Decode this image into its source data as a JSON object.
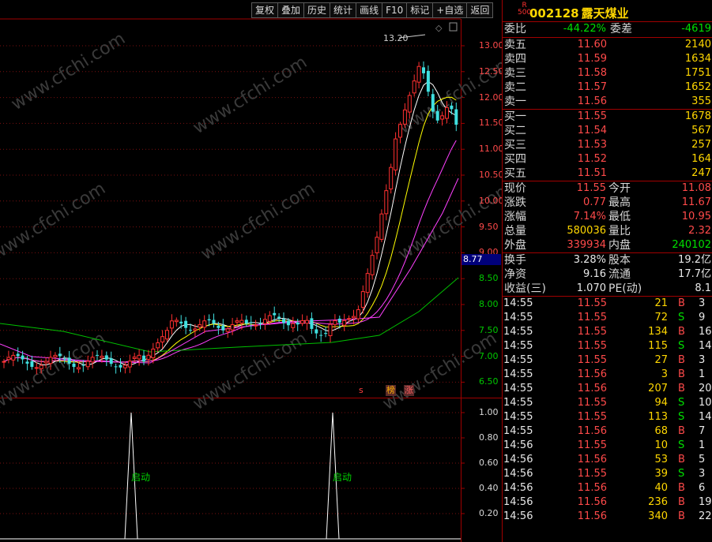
{
  "toolbar": {
    "buttons": [
      "复权",
      "叠加",
      "历史",
      "统计",
      "画线",
      "F10",
      "标记",
      "+自选",
      "返回"
    ]
  },
  "chart": {
    "peak_label": "13.20",
    "price_axis": [
      {
        "v": "13.00",
        "c": "red"
      },
      {
        "v": "12.50",
        "c": "red"
      },
      {
        "v": "12.00",
        "c": "red"
      },
      {
        "v": "11.50",
        "c": "red"
      },
      {
        "v": "11.00",
        "c": "red"
      },
      {
        "v": "10.50",
        "c": "red"
      },
      {
        "v": "10.00",
        "c": "red"
      },
      {
        "v": "9.50",
        "c": "red"
      },
      {
        "v": "9.00",
        "c": "red"
      },
      {
        "v": "8.50",
        "c": "green"
      },
      {
        "v": "8.00",
        "c": "green"
      },
      {
        "v": "7.50",
        "c": "green"
      },
      {
        "v": "7.00",
        "c": "green"
      },
      {
        "v": "6.50",
        "c": "green"
      }
    ],
    "current_price_box": "8.77",
    "tags": [
      {
        "t": "s",
        "c": "#ff4040"
      },
      {
        "t": "榜",
        "c": "#ffb000"
      },
      {
        "t": "涨",
        "c": "#ff6060"
      }
    ],
    "indicator_axis": [
      "1.00",
      "0.80",
      "0.60",
      "0.40",
      "0.20"
    ],
    "indicator_label": "启动",
    "watermark": "www.cfchi.com"
  },
  "panel": {
    "r_badge_top": "R",
    "r_badge_bottom": "500",
    "code": "002128",
    "name": "露天煤业",
    "weibi_label": "委比",
    "weibi_value": "-44.22%",
    "weicha_label": "委差",
    "weicha_value": "-4619",
    "sells": [
      {
        "label": "卖五",
        "price": "11.60",
        "vol": "2140"
      },
      {
        "label": "卖四",
        "price": "11.59",
        "vol": "1634"
      },
      {
        "label": "卖三",
        "price": "11.58",
        "vol": "1751"
      },
      {
        "label": "卖二",
        "price": "11.57",
        "vol": "1652"
      },
      {
        "label": "卖一",
        "price": "11.56",
        "vol": "355"
      }
    ],
    "buys": [
      {
        "label": "买一",
        "price": "11.55",
        "vol": "1678"
      },
      {
        "label": "买二",
        "price": "11.54",
        "vol": "567"
      },
      {
        "label": "买三",
        "price": "11.53",
        "vol": "257"
      },
      {
        "label": "买四",
        "price": "11.52",
        "vol": "164"
      },
      {
        "label": "买五",
        "price": "11.51",
        "vol": "247"
      }
    ],
    "quote": [
      {
        "l1": "现价",
        "v1": "11.55",
        "c1": "red",
        "l2": "今开",
        "v2": "11.08",
        "c2": "red"
      },
      {
        "l1": "涨跌",
        "v1": "0.77",
        "c1": "red",
        "l2": "最高",
        "v2": "11.67",
        "c2": "red"
      },
      {
        "l1": "涨幅",
        "v1": "7.14%",
        "c1": "red",
        "l2": "最低",
        "v2": "10.95",
        "c2": "red"
      },
      {
        "l1": "总量",
        "v1": "580036",
        "c1": "yellow",
        "l2": "量比",
        "v2": "2.32",
        "c2": "red"
      },
      {
        "l1": "外盘",
        "v1": "339934",
        "c1": "red",
        "l2": "内盘",
        "v2": "240102",
        "c2": "green"
      }
    ],
    "fund": [
      {
        "l1": "换手",
        "v1": "3.28%",
        "l2": "股本",
        "v2": "19.2亿"
      },
      {
        "l1": "净资",
        "v1": "9.16",
        "l2": "流通",
        "v2": "17.7亿"
      },
      {
        "l1": "收益(三)",
        "v1": "1.070",
        "l2": "PE(动)",
        "v2": "8.1"
      }
    ],
    "ticks": [
      {
        "t": "14:55",
        "p": "11.55",
        "v": "21",
        "bs": "B",
        "n": "3"
      },
      {
        "t": "14:55",
        "p": "11.55",
        "v": "72",
        "bs": "S",
        "n": "9"
      },
      {
        "t": "14:55",
        "p": "11.55",
        "v": "134",
        "bs": "B",
        "n": "16"
      },
      {
        "t": "14:55",
        "p": "11.55",
        "v": "115",
        "bs": "S",
        "n": "14"
      },
      {
        "t": "14:55",
        "p": "11.55",
        "v": "27",
        "bs": "B",
        "n": "3"
      },
      {
        "t": "14:55",
        "p": "11.56",
        "v": "3",
        "bs": "B",
        "n": "1"
      },
      {
        "t": "14:55",
        "p": "11.56",
        "v": "207",
        "bs": "B",
        "n": "20"
      },
      {
        "t": "14:55",
        "p": "11.55",
        "v": "94",
        "bs": "S",
        "n": "10"
      },
      {
        "t": "14:55",
        "p": "11.55",
        "v": "113",
        "bs": "S",
        "n": "14"
      },
      {
        "t": "14:55",
        "p": "11.56",
        "v": "68",
        "bs": "B",
        "n": "7"
      },
      {
        "t": "14:56",
        "p": "11.55",
        "v": "10",
        "bs": "S",
        "n": "1"
      },
      {
        "t": "14:56",
        "p": "11.56",
        "v": "53",
        "bs": "B",
        "n": "5"
      },
      {
        "t": "14:56",
        "p": "11.55",
        "v": "39",
        "bs": "S",
        "n": "3"
      },
      {
        "t": "14:56",
        "p": "11.56",
        "v": "40",
        "bs": "B",
        "n": "6"
      },
      {
        "t": "14:56",
        "p": "11.56",
        "v": "236",
        "bs": "B",
        "n": "19"
      },
      {
        "t": "14:56",
        "p": "11.56",
        "v": "340",
        "bs": "B",
        "n": "22"
      }
    ]
  }
}
